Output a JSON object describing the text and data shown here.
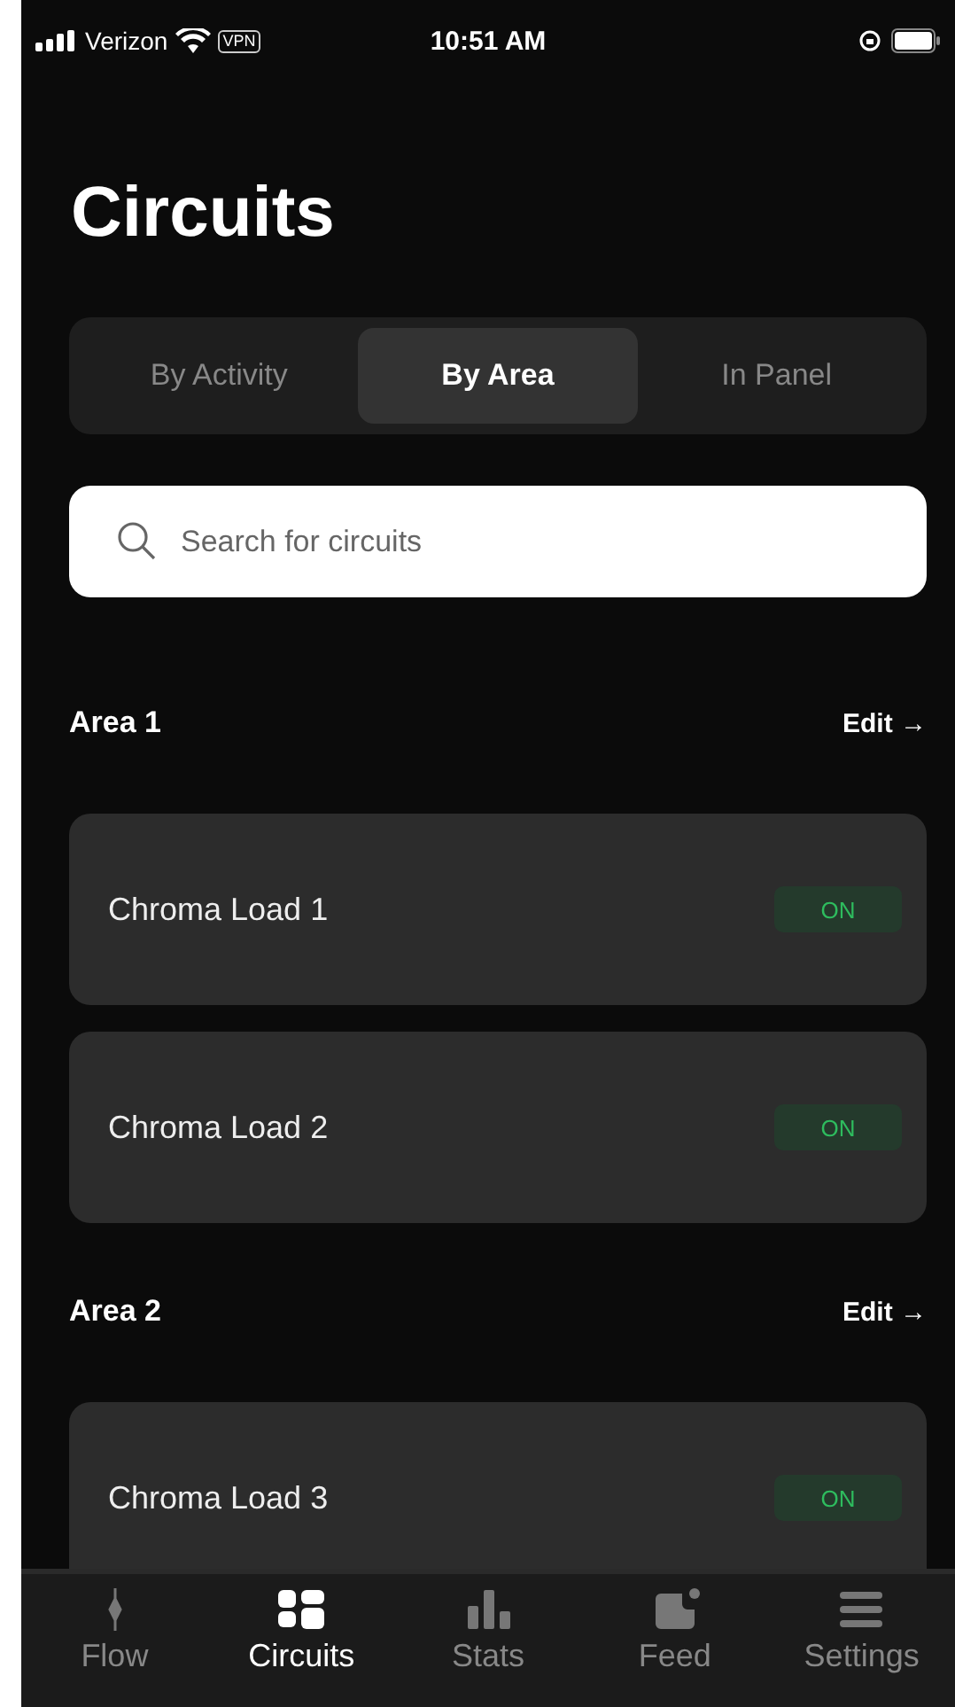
{
  "status_bar": {
    "carrier": "Verizon",
    "vpn": "VPN",
    "time": "10:51 AM"
  },
  "title": "Circuits",
  "tabs": [
    {
      "label": "By Activity",
      "selected": false
    },
    {
      "label": "By Area",
      "selected": true
    },
    {
      "label": "In Panel",
      "selected": false
    }
  ],
  "search": {
    "placeholder": "Search for circuits"
  },
  "areas": [
    {
      "name": "Area 1",
      "action": "Edit →",
      "circuits": [
        {
          "name": "Chroma Load 1",
          "status": "ON",
          "on": true
        },
        {
          "name": "Chroma Load 2",
          "status": "ON",
          "on": true
        }
      ]
    },
    {
      "name": "Area 2",
      "action": "Edit →",
      "circuits": [
        {
          "name": "Chroma Load 3",
          "status": "ON",
          "on": true
        }
      ]
    }
  ],
  "nav": [
    {
      "label": "Flow",
      "selected": false
    },
    {
      "label": "Circuits",
      "selected": true
    },
    {
      "label": "Stats",
      "selected": false
    },
    {
      "label": "Feed",
      "selected": false
    },
    {
      "label": "Settings",
      "selected": false
    }
  ]
}
